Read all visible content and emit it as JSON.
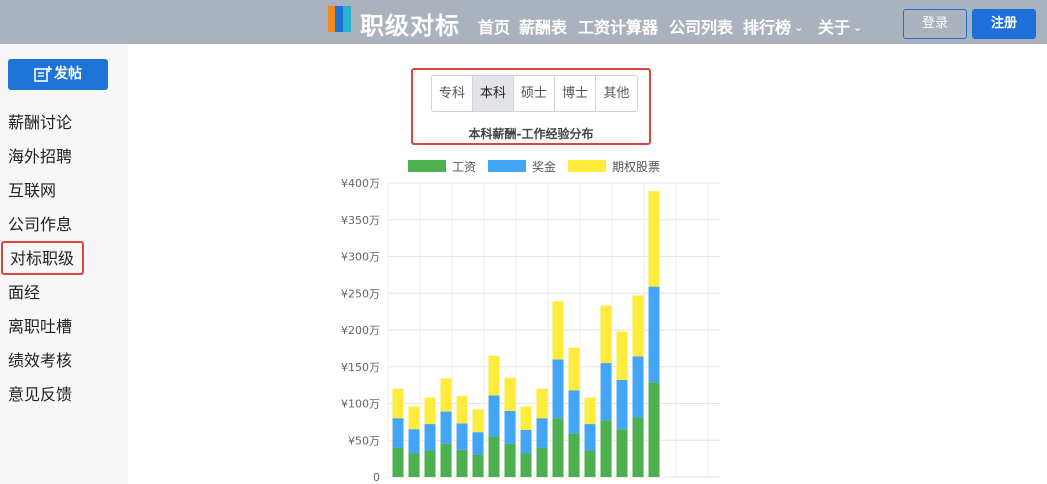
{
  "header": {
    "brand": "职级对标",
    "nav": [
      {
        "label": "首页",
        "chevron": false
      },
      {
        "label": "薪酬表",
        "chevron": false
      },
      {
        "label": "工资计算器",
        "chevron": false
      },
      {
        "label": "公司列表",
        "chevron": false
      },
      {
        "label": "排行榜",
        "chevron": true
      },
      {
        "label": "关于",
        "chevron": true
      }
    ],
    "login_label": "登录",
    "register_label": "注册",
    "colors": {
      "bar": "#a9b2bd",
      "primary": "#1e6fd9"
    }
  },
  "sidebar": {
    "post_label": "发帖",
    "items": [
      {
        "label": "薪酬讨论",
        "active": false
      },
      {
        "label": "海外招聘",
        "active": false
      },
      {
        "label": "互联网",
        "active": false
      },
      {
        "label": "公司作息",
        "active": false
      },
      {
        "label": "对标职级",
        "active": true
      },
      {
        "label": "面经",
        "active": false
      },
      {
        "label": "离职吐槽",
        "active": false
      },
      {
        "label": "绩效考核",
        "active": false
      },
      {
        "label": "意见反馈",
        "active": false
      }
    ]
  },
  "degree_tabs": {
    "items": [
      "专科",
      "本科",
      "硕士",
      "博士",
      "其他"
    ],
    "selected": "本科"
  },
  "chart_data": {
    "type": "bar",
    "stacked": true,
    "title": "本科薪酬-工作经验分布",
    "legend_position": "top",
    "ylim": [
      0,
      400
    ],
    "y_ticks": [
      "0",
      "¥50万",
      "¥100万",
      "¥150万",
      "¥200万",
      "¥250万",
      "¥300万",
      "¥350万",
      "¥400万"
    ],
    "grid": true,
    "series": [
      {
        "name": "工资",
        "color": "#4caf50",
        "values": [
          40,
          32,
          36,
          45,
          37,
          30,
          55,
          45,
          32,
          40,
          80,
          59,
          36,
          77,
          65,
          81,
          129
        ]
      },
      {
        "name": "奖金",
        "color": "#42a5f5",
        "values": [
          40,
          33,
          36,
          44,
          36,
          31,
          56,
          45,
          32,
          40,
          80,
          59,
          36,
          78,
          67,
          83,
          130
        ]
      },
      {
        "name": "期权股票",
        "color": "#ffeb3b",
        "values": [
          40,
          31,
          36,
          45,
          37,
          31,
          54,
          45,
          32,
          40,
          79,
          58,
          36,
          78,
          66,
          83,
          130
        ]
      }
    ]
  }
}
